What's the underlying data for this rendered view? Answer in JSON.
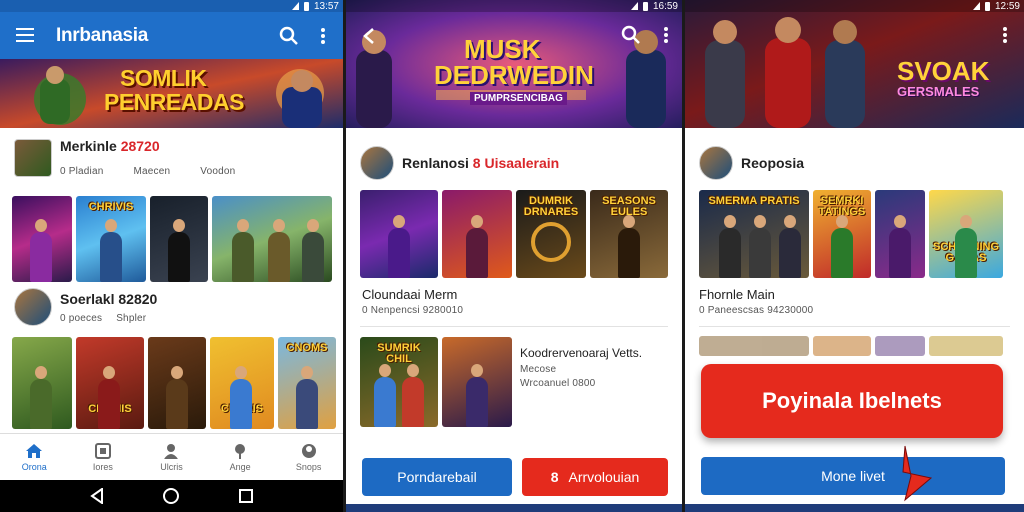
{
  "status": {
    "time1": "13:57",
    "time2": "16:59",
    "time3": "12:59"
  },
  "screen1": {
    "app_title": "Inrbanasia",
    "banner_text_1": "SOMLIK",
    "banner_text_2": "PENREADAS",
    "section1": {
      "title": "Merkinle ",
      "title_num": "28720",
      "meta": [
        "0 Pladian",
        "Maecen",
        "Voodon"
      ]
    },
    "section2": {
      "title": "Soerlakl 82820",
      "meta": [
        "0 poeces",
        "Shpler"
      ]
    },
    "thumbs_row1": [
      "",
      "CHRIVIS",
      "",
      "",
      ""
    ],
    "thumbs_row2": [
      "",
      "CIRIRIIS",
      "",
      "CHARIS",
      "CNOMS"
    ],
    "nav": [
      {
        "label": "Orona",
        "icon": "home-icon"
      },
      {
        "label": "Iores",
        "icon": "grid-icon"
      },
      {
        "label": "Ulcris",
        "icon": "person-icon"
      },
      {
        "label": "Ange",
        "icon": "pin-icon"
      },
      {
        "label": "Snops",
        "icon": "profile-icon"
      }
    ]
  },
  "screen2": {
    "banner_text_1": "MUSK",
    "banner_text_2": "DEDRWEDIN",
    "banner_text_3": "PUMPRSENCIBAG",
    "section1": {
      "title": "Renlanosi ",
      "title_hl": "8 Uisaalerain"
    },
    "thumbs": [
      "",
      "",
      "DUMRIK DRNARES",
      "SEASONS EULES"
    ],
    "caption": "Cloundaai Merm",
    "caption_sub": "0 Nenpencsi 9280010",
    "row_title": "Koodrervenoaraj Vetts.",
    "row_sub_1": "Mecose",
    "row_sub_2": "Wrcoanuel 0800",
    "thumb_a": "SUMRIK CHIL",
    "btn_primary": "Porndarebail",
    "btn_secondary": "Arrvolouian",
    "btn_secondary_prefix": "8"
  },
  "screen3": {
    "banner_text_1": "SVOAK",
    "banner_text_2": "GERSMALES",
    "section1": {
      "title": "Reoposia"
    },
    "thumbs": [
      "SMERMA PRATIS",
      "SEMRKI TATINGS",
      "",
      "SCHIMINING GAMAS"
    ],
    "caption": "Fhornle Main",
    "caption_sub": "0 Paneescsas 94230000",
    "cta_primary": "Poyinala Ibelnets",
    "cta_secondary": "Mone livet"
  },
  "colors": {
    "appbar": "#1f6fc9",
    "cta_red": "#e52a1d",
    "button_blue": "#1d6ac3"
  }
}
